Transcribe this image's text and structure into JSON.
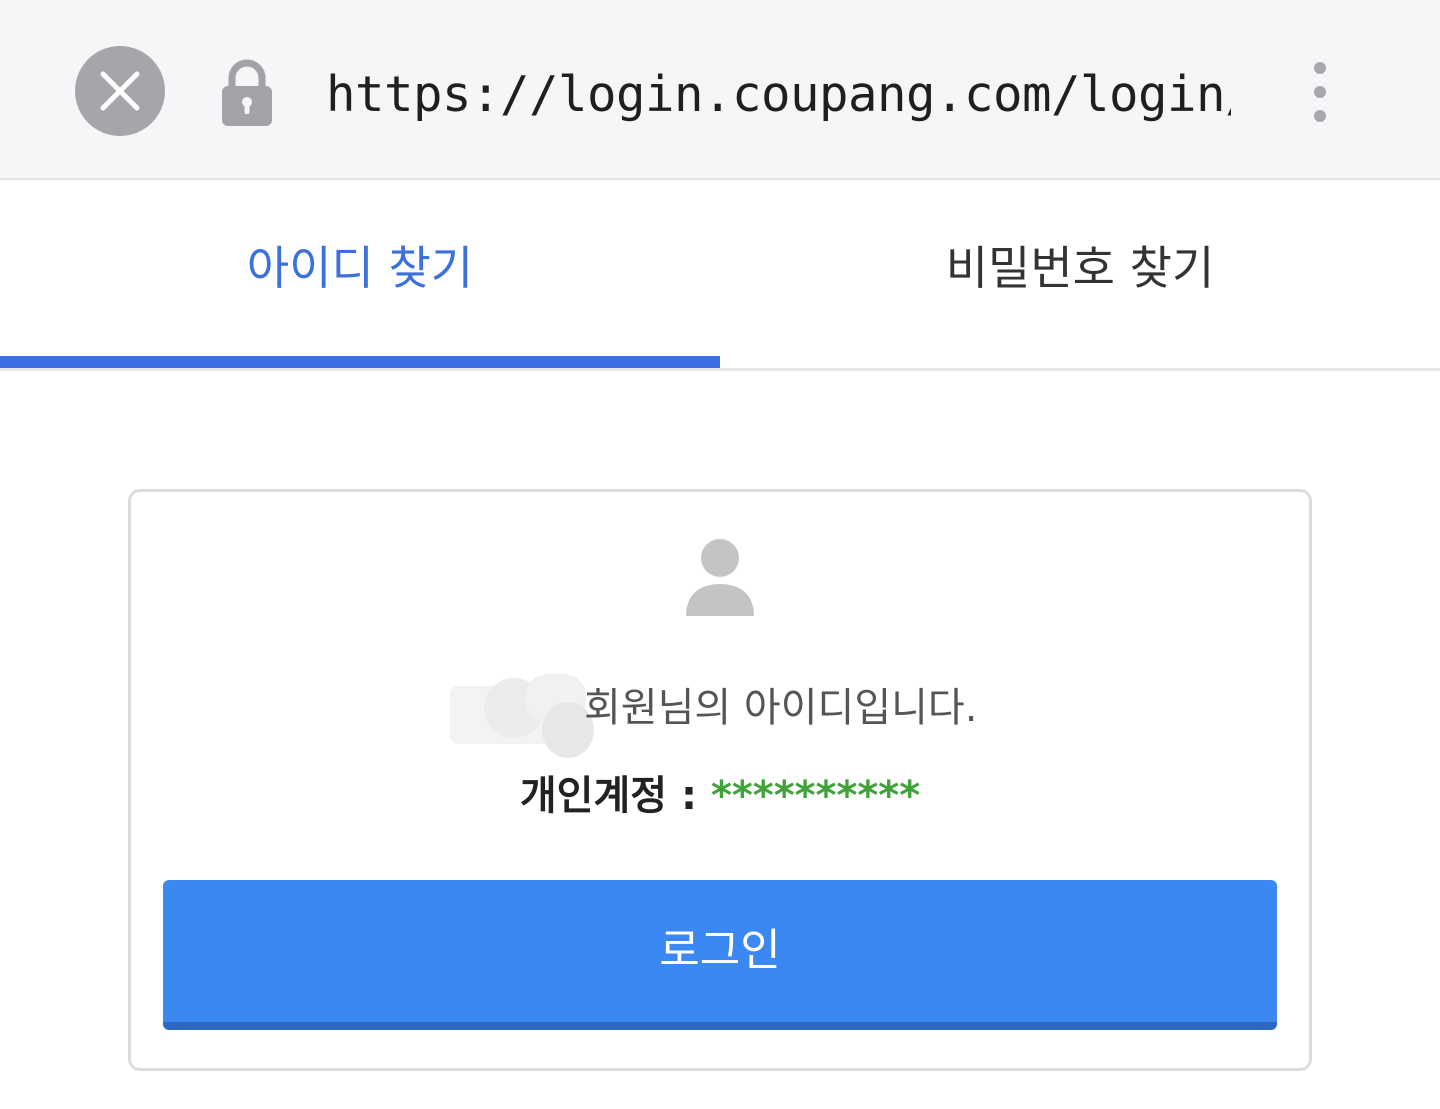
{
  "browser": {
    "url": "https://login.coupang.com/login/acco",
    "close_icon": "close-icon",
    "lock_icon": "lock-icon",
    "menu_icon": "more-vertical-icon"
  },
  "tabs": [
    {
      "label": "아이디 찾기",
      "active": true
    },
    {
      "label": "비밀번호 찾기",
      "active": false
    }
  ],
  "result": {
    "avatar_icon": "user-avatar-icon",
    "message": "회원님의 아이디입니다.",
    "account_label": "개인계정 : ",
    "account_id": "**********"
  },
  "actions": {
    "login_label": "로그인"
  },
  "colors": {
    "accent": "#3d6ee6",
    "button": "#3c88f2",
    "masked_id": "#3fa338"
  }
}
